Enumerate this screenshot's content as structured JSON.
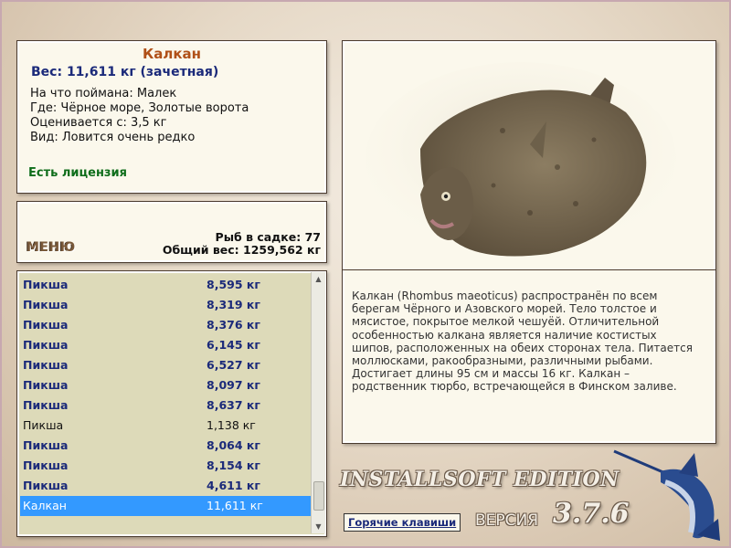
{
  "info": {
    "title": "Калкан",
    "weight": "Вес: 11,611 кг (зачетная)",
    "caught_on": "На что поймана: Малек",
    "where": "Где: Чёрное море, Золотые ворота",
    "value": "Оценивается с: 3,5 кг",
    "kind": "Вид: Ловится очень редко",
    "license": "Есть лицензия"
  },
  "stats": {
    "menu_label": "МЕНЮ",
    "fish_in_keepnet": "Рыб в садке: 77",
    "total_weight": "Общий вес: 1259,562 кг"
  },
  "fish_list": [
    {
      "name": "Пикша",
      "weight": "8,595 кг",
      "style": "bold"
    },
    {
      "name": "Пикша",
      "weight": "8,319 кг",
      "style": "bold"
    },
    {
      "name": "Пикша",
      "weight": "8,376 кг",
      "style": "bold"
    },
    {
      "name": "Пикша",
      "weight": "6,145 кг",
      "style": "bold"
    },
    {
      "name": "Пикша",
      "weight": "6,527 кг",
      "style": "bold"
    },
    {
      "name": "Пикша",
      "weight": "8,097 кг",
      "style": "bold"
    },
    {
      "name": "Пикша",
      "weight": "8,637 кг",
      "style": "bold"
    },
    {
      "name": "Пикша",
      "weight": "1,138 кг",
      "style": "plain"
    },
    {
      "name": "Пикша",
      "weight": "8,064 кг",
      "style": "bold"
    },
    {
      "name": "Пикша",
      "weight": "8,154 кг",
      "style": "bold"
    },
    {
      "name": "Пикша",
      "weight": "4,611 кг",
      "style": "bold"
    },
    {
      "name": "Калкан",
      "weight": "11,611 кг",
      "style": "selected"
    }
  ],
  "description": "Калкан (Rhombus maeoticus) распространён по всем берегам Чёрного и Азовского морей. Тело толстое и мясистое, покрытое мелкой чешуёй. Отличительной особенностью калкана является наличие костистых шипов, расположенных на обеих сторонах тела. Питается моллюсками, ракообразными, различными рыбами. Достигает длины 95 см и массы 16 кг. Калкан – родственник тюрбо, встречающейся в Финском заливе.",
  "branding": {
    "edition": "INSTALLSOFT EDITION",
    "version_label": "ВЕРСИЯ",
    "version_number": "3.7.6"
  },
  "hotkeys_label": "Горячие клавиши",
  "colors": {
    "title": "#b05018",
    "accent_blue": "#1b2a7a",
    "license_green": "#0e6d1a",
    "selection": "#3399ff",
    "panel_bg": "#fbf8ec"
  },
  "icons": [
    "fish-image",
    "marlin-logo"
  ]
}
